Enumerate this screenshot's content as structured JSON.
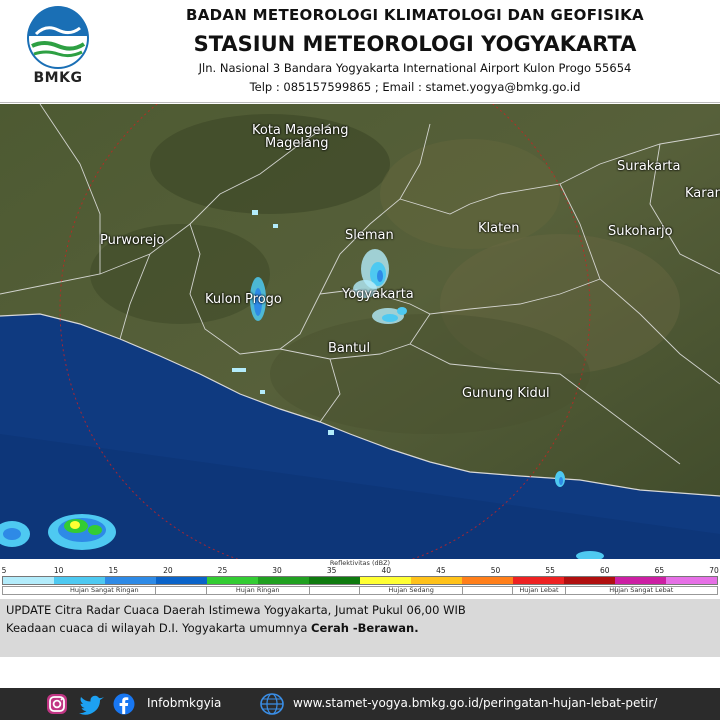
{
  "header": {
    "agency": "BADAN METEOROLOGI KLIMATOLOGI DAN GEOFISIKA",
    "station": "STASIUN METEOROLOGI YOGYAKARTA",
    "address": "Jln. Nasional 3 Bandara Yogyakarta International Airport Kulon Progo 55654",
    "contact": "Telp : 085157599865  ;  Email : stamet.yogya@bmkg.go.id",
    "logo_text": "BMKG"
  },
  "map": {
    "places": [
      {
        "name": "Kota Magelang"
      },
      {
        "name": "Magelang"
      },
      {
        "name": "Surakarta"
      },
      {
        "name": "Karanganyar"
      },
      {
        "name": "Purworejo"
      },
      {
        "name": "Sleman"
      },
      {
        "name": "Klaten"
      },
      {
        "name": "Sukoharjo"
      },
      {
        "name": "Kulon Progo"
      },
      {
        "name": "Yogyakarta"
      },
      {
        "name": "Bantul"
      },
      {
        "name": "Gunung Kidul"
      }
    ]
  },
  "legend": {
    "title": "Reflektivitas (dBZ)",
    "ticks": [
      "5",
      "10",
      "15",
      "20",
      "25",
      "30",
      "35",
      "40",
      "45",
      "50",
      "55",
      "60",
      "65",
      "70"
    ],
    "colors": [
      "#b3ecfb",
      "#4ec9f1",
      "#2e8ae6",
      "#0a63c9",
      "#33cc33",
      "#20a020",
      "#0f7a0f",
      "#ffff33",
      "#ffc21a",
      "#ff7f1a",
      "#ee2222",
      "#b00f0f",
      "#cc1fa3",
      "#e670e6"
    ],
    "categories": [
      "Hujan Sangat Ringan",
      "Hujan Ringan",
      "Hujan Sedang",
      "Hujan Lebat",
      "Hujan Sangat Lebat"
    ]
  },
  "info": {
    "title": "UPDATE Citra Radar Cuaca Daerah Istimewa Yogyakarta, Jumat Pukul 06,00 WIB",
    "text_prefix": "Keadaan cuaca di wilayah D.I. Yogyakarta umumnya ",
    "text_bold": "Cerah -Berawan."
  },
  "footer": {
    "handle": "Infobmkgyia",
    "url": "www.stamet-yogya.bmkg.go.id/peringatan-hujan-lebat-petir/",
    "icons": [
      "instagram-icon",
      "twitter-icon",
      "facebook-icon",
      "globe-icon"
    ]
  }
}
